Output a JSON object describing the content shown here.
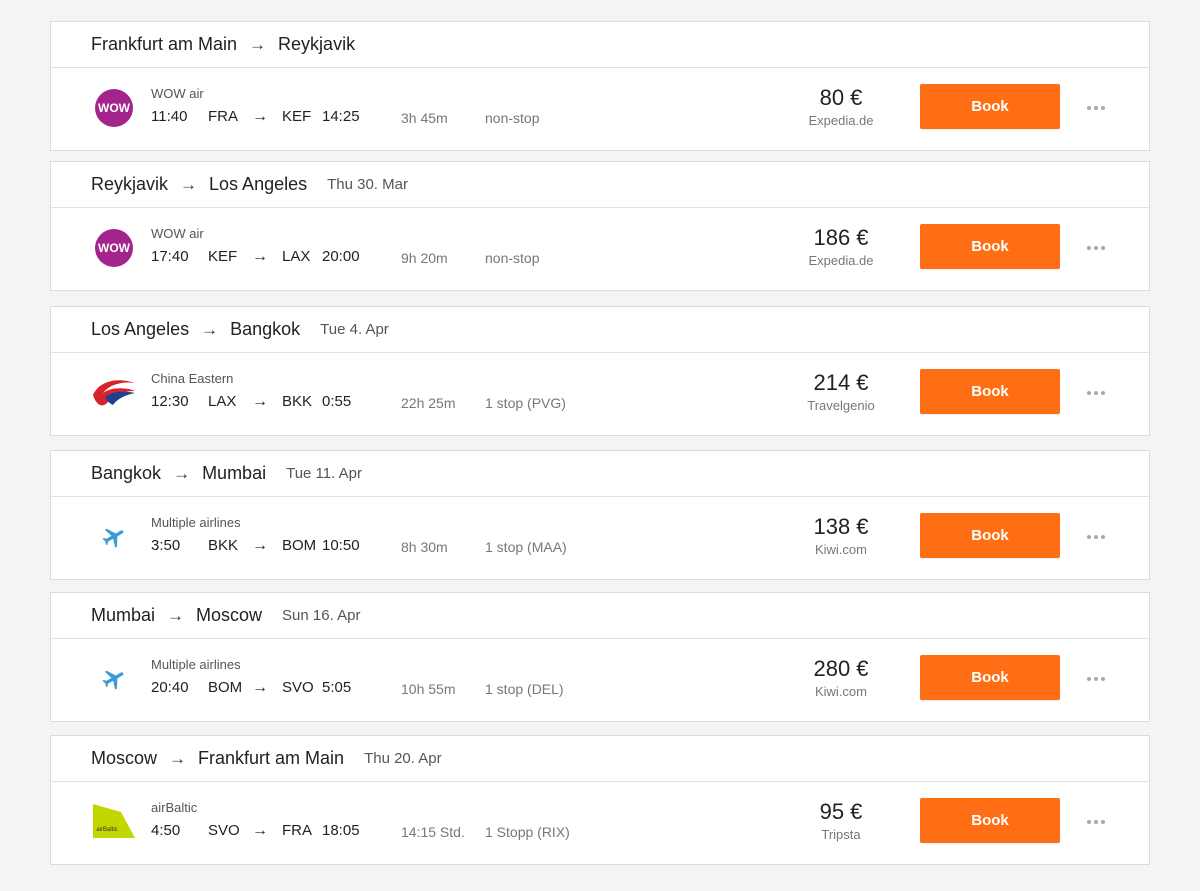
{
  "trips": [
    {
      "from": "Frankfurt am Main",
      "arrow": "→",
      "to": "Reykjavik",
      "date": "",
      "airline": "WOW air",
      "logo": "wow-air-logo",
      "dep_time": "11:40",
      "dep_airport": "FRA",
      "leg_arrow": "→",
      "arr_airport": "KEF",
      "arr_time": "14:25",
      "duration": "3h 45m",
      "stops": "non-stop",
      "price": "80 €",
      "provider": "Expedia.de",
      "book_label": "Book",
      "more_icon": "more-dots-icon"
    },
    {
      "from": "Reykjavik",
      "arrow": "→",
      "to": "Los Angeles",
      "date": "Thu 30. Mar",
      "airline": "WOW air",
      "logo": "wow-air-logo",
      "dep_time": "17:40",
      "dep_airport": "KEF",
      "leg_arrow": "→",
      "arr_airport": "LAX",
      "arr_time": "20:00",
      "duration": "9h 20m",
      "stops": "non-stop",
      "price": "186 €",
      "provider": "Expedia.de",
      "book_label": "Book",
      "more_icon": "more-dots-icon"
    },
    {
      "from": "Los Angeles",
      "arrow": "→",
      "to": "Bangkok",
      "date": "Tue 4. Apr",
      "airline": "China Eastern",
      "logo": "china-eastern-logo",
      "dep_time": "12:30",
      "dep_airport": "LAX",
      "leg_arrow": "→",
      "arr_airport": "BKK",
      "arr_time": "0:55",
      "duration": "22h 25m",
      "stops": "1 stop (PVG)",
      "price": "214 €",
      "provider": "Travelgenio",
      "book_label": "Book",
      "more_icon": "more-dots-icon"
    },
    {
      "from": "Bangkok",
      "arrow": "→",
      "to": "Mumbai",
      "date": "Tue 11. Apr",
      "airline": "Multiple airlines",
      "logo": "plane-icon",
      "dep_time": "3:50",
      "dep_airport": "BKK",
      "leg_arrow": "→",
      "arr_airport": "BOM",
      "arr_time": "10:50",
      "duration": "8h 30m",
      "stops": "1 stop (MAA)",
      "price": "138 €",
      "provider": "Kiwi.com",
      "book_label": "Book",
      "more_icon": "more-dots-icon"
    },
    {
      "from": "Mumbai",
      "arrow": "→",
      "to": "Moscow",
      "date": "Sun 16. Apr",
      "airline": "Multiple airlines",
      "logo": "plane-icon",
      "dep_time": "20:40",
      "dep_airport": "BOM",
      "leg_arrow": "→",
      "arr_airport": "SVO",
      "arr_time": "5:05",
      "duration": "10h 55m",
      "stops": "1 stop (DEL)",
      "price": "280 €",
      "provider": "Kiwi.com",
      "book_label": "Book",
      "more_icon": "more-dots-icon"
    },
    {
      "from": "Moscow",
      "arrow": "→",
      "to": "Frankfurt am Main",
      "date": "Thu 20. Apr",
      "airline": "airBaltic",
      "logo": "airbaltic-logo",
      "dep_time": "4:50",
      "dep_airport": "SVO",
      "leg_arrow": "→",
      "arr_airport": "FRA",
      "arr_time": "18:05",
      "duration": "14:15 Std.",
      "stops": "1 Stopp (RIX)",
      "price": "95 €",
      "provider": "Tripsta",
      "book_label": "Book",
      "more_icon": "more-dots-icon"
    }
  ],
  "logo_text": {
    "wow": "WOW",
    "airbaltic": "airBaltic"
  },
  "colors": {
    "book_button": "#ff6e14",
    "wow_purple": "#a4248e",
    "china_eastern_red": "#d8232a",
    "china_eastern_blue": "#1f3f8f",
    "plane_blue": "#3a9bd5",
    "airbaltic_green": "#c4d600"
  }
}
